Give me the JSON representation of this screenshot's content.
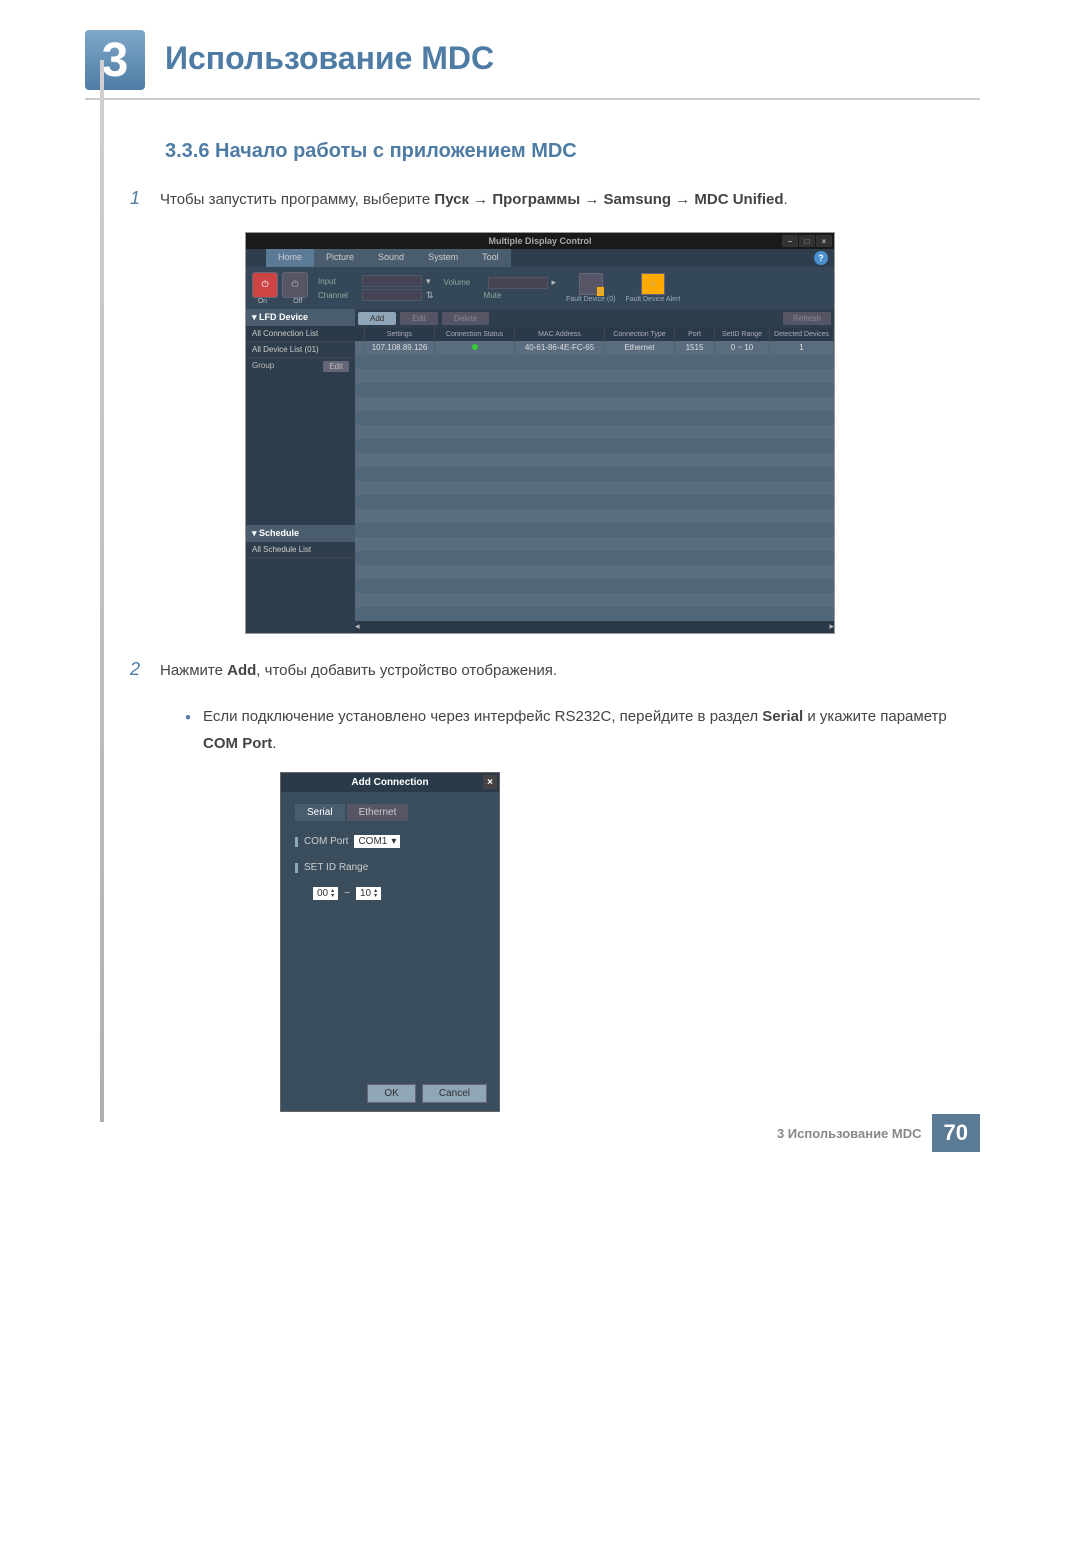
{
  "chapter": {
    "number": "3",
    "title": "Использование MDC"
  },
  "section": {
    "number": "3.3.6",
    "title": "Начало работы с приложением MDC"
  },
  "steps": {
    "1": {
      "n": "1",
      "pre": "Чтобы запустить программу, выберите ",
      "path": "Пуск → Программы → Samsung → MDC Unified",
      "post": "."
    },
    "2": {
      "n": "2",
      "pre": "Нажмите ",
      "b": "Add",
      "post": ", чтобы добавить устройство отображения."
    }
  },
  "bullet": {
    "pre": "Если подключение установлено через интерфейс RS232C, перейдите в раздел ",
    "b1": "Serial",
    "mid": " и укажите параметр ",
    "b2": "COM Port",
    "post": "."
  },
  "mdc": {
    "win_title": "Multiple Display Control",
    "tabs": [
      "Home",
      "Picture",
      "Sound",
      "System",
      "Tool"
    ],
    "help": "?",
    "power": {
      "on": "On",
      "off": "Off"
    },
    "tool": {
      "input": "Input",
      "channel": "Channel",
      "volume": "Volume",
      "mute": "Mute"
    },
    "fault": {
      "dev": "Fault Device (0)",
      "alert": "Fault Device Alert"
    },
    "sidebar": {
      "lfd": "LFD Device",
      "all_conn": "All Connection List",
      "all_dev": "All Device List (01)",
      "group": "Group",
      "edit": "Edit",
      "schedule": "Schedule",
      "all_sched": "All Schedule List"
    },
    "actions": {
      "add": "Add",
      "edit": "Edit",
      "delete": "Delete",
      "refresh": "Refresh"
    },
    "headers": {
      "settings": "Settings",
      "conn": "Connection Status",
      "mac": "MAC Address",
      "type": "Connection Type",
      "port": "Port",
      "range": "SetID Range",
      "det": "Detected Devices"
    },
    "row": {
      "settings": "107.108.89.126",
      "mac": "40-61-86-4E-FC-65",
      "type": "Ethernet",
      "port": "1515",
      "range": "0 ~ 10",
      "det": "1"
    }
  },
  "dialog": {
    "title": "Add Connection",
    "tabs": {
      "serial": "Serial",
      "ethernet": "Ethernet"
    },
    "comport": {
      "label": "COM Port",
      "value": "COM1"
    },
    "setid": {
      "label": "SET ID Range",
      "from": "00",
      "to": "10",
      "sep": "~"
    },
    "ok": "OK",
    "cancel": "Cancel"
  },
  "footer": {
    "text": "3 Использование MDC",
    "page": "70"
  }
}
